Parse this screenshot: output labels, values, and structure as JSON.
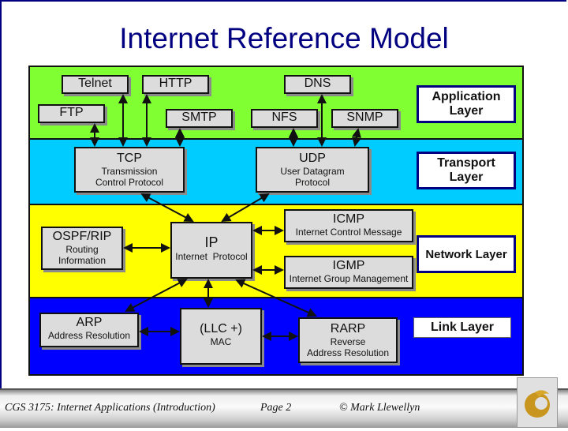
{
  "title": "Internet Reference Model",
  "layers": {
    "application": "Application Layer",
    "transport": "Transport Layer",
    "network": "Network Layer",
    "link": "Link Layer"
  },
  "boxes": {
    "telnet": {
      "main": "Telnet"
    },
    "http": {
      "main": "HTTP"
    },
    "dns": {
      "main": "DNS"
    },
    "ftp": {
      "main": "FTP"
    },
    "smtp": {
      "main": "SMTP"
    },
    "nfs": {
      "main": "NFS"
    },
    "snmp": {
      "main": "SNMP"
    },
    "tcp": {
      "main": "TCP",
      "sub1": "Transmission",
      "sub2": "Control Protocol"
    },
    "udp": {
      "main": "UDP",
      "sub1": "User Datagram",
      "sub2": "Protocol"
    },
    "ospf": {
      "main": "OSPF/RIP",
      "sub1": "Routing",
      "sub2": "Information"
    },
    "ip": {
      "main": "IP",
      "sub1": "Internet  Protocol"
    },
    "icmp": {
      "main": "ICMP",
      "sub1": "Internet Control Message"
    },
    "igmp": {
      "main": "IGMP",
      "sub1": "Internet Group Management"
    },
    "arp": {
      "main": "ARP",
      "sub1": "Address Resolution"
    },
    "mac": {
      "main": "(LLC +)",
      "sub1": "MAC"
    },
    "rarp": {
      "main": "RARP",
      "sub1": "Reverse",
      "sub2": "Address Resolution"
    }
  },
  "colors": {
    "application": "#80ff33",
    "transport": "#00ccff",
    "network": "#ffff00",
    "link": "#0000ff",
    "title": "#000080"
  },
  "footer": {
    "course": "CGS 3175: Internet Applications (Introduction)",
    "page": "Page 2",
    "author": "© Mark Llewellyn",
    "logo_icon": "pegasus-logo-icon"
  }
}
